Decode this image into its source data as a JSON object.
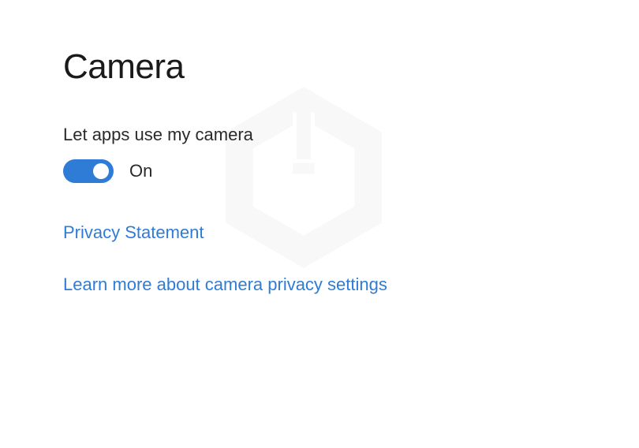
{
  "page": {
    "title": "Camera",
    "setting_label": "Let apps use my camera",
    "toggle": {
      "state_label": "On",
      "enabled": true
    },
    "links": {
      "privacy_statement": "Privacy Statement",
      "learn_more": "Learn more about camera privacy settings"
    },
    "colors": {
      "accent": "#2f7cd6",
      "text": "#2a2a2a",
      "link": "#2f7cd6"
    }
  }
}
